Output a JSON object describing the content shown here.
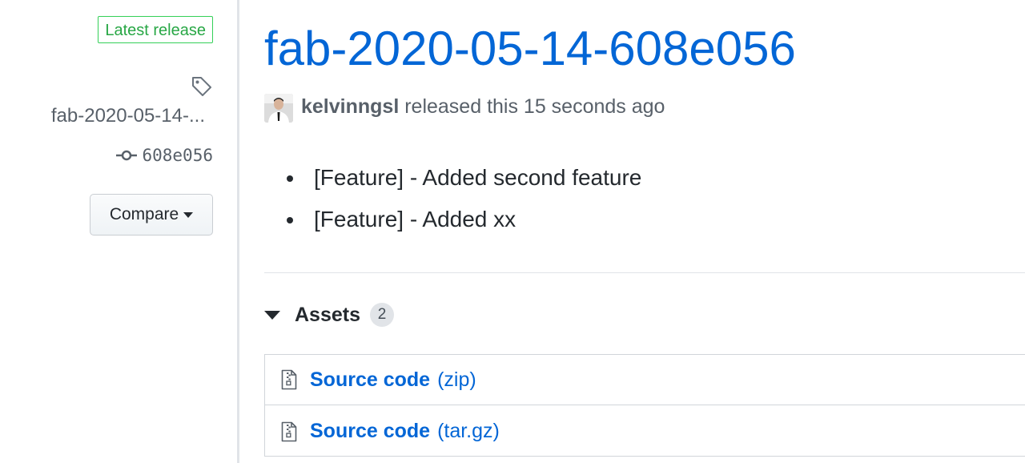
{
  "sidebar": {
    "badge_label": "Latest release",
    "tag_icon": "tag-icon",
    "tag_name": "fab-2020-05-14-...",
    "commit_icon": "git-commit-icon",
    "commit_sha": "608e056",
    "compare_label": "Compare"
  },
  "release": {
    "title": "fab-2020-05-14-608e056",
    "author": "kelvinngsl",
    "released_text": "released this 15 seconds ago",
    "notes": [
      "[Feature] - Added second feature",
      "[Feature] - Added xx"
    ]
  },
  "assets": {
    "label": "Assets",
    "count": "2",
    "items": [
      {
        "name": "Source code",
        "ext": "(zip)",
        "icon": "file-zip-icon"
      },
      {
        "name": "Source code",
        "ext": "(tar.gz)",
        "icon": "file-zip-icon"
      }
    ]
  },
  "colors": {
    "link": "#0366d6",
    "latest_badge": "#28a745",
    "muted_text": "#586069",
    "border": "#e1e4e8"
  }
}
